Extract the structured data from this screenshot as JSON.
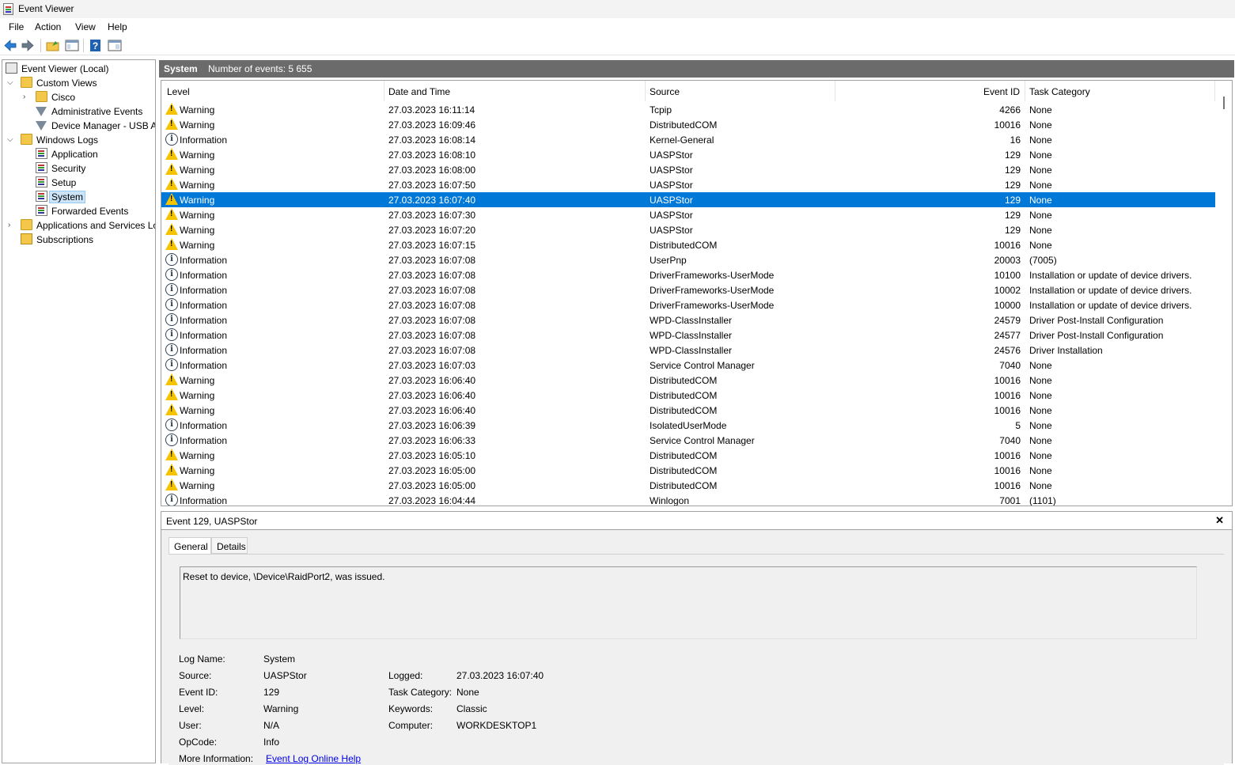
{
  "window": {
    "title": "Event Viewer"
  },
  "menu": [
    "File",
    "Action",
    "View",
    "Help"
  ],
  "tree": {
    "root": "Event Viewer (Local)",
    "custom_views": "Custom Views",
    "cisco": "Cisco",
    "admin_events": "Administrative Events",
    "device_manager": "Device Manager - USB At",
    "windows_logs": "Windows Logs",
    "application": "Application",
    "security": "Security",
    "setup": "Setup",
    "system": "System",
    "forwarded": "Forwarded Events",
    "apps_services": "Applications and Services Lo",
    "subscriptions": "Subscriptions"
  },
  "list": {
    "title": "System",
    "count": "Number of events: 5 655",
    "columns": [
      "Level",
      "Date and Time",
      "Source",
      "Event ID",
      "Task Category"
    ],
    "rows": [
      [
        "Warning",
        "27.03.2023 16:11:14",
        "Tcpip",
        "4266",
        "None"
      ],
      [
        "Warning",
        "27.03.2023 16:09:46",
        "DistributedCOM",
        "10016",
        "None"
      ],
      [
        "Information",
        "27.03.2023 16:08:14",
        "Kernel-General",
        "16",
        "None"
      ],
      [
        "Warning",
        "27.03.2023 16:08:10",
        "UASPStor",
        "129",
        "None"
      ],
      [
        "Warning",
        "27.03.2023 16:08:00",
        "UASPStor",
        "129",
        "None"
      ],
      [
        "Warning",
        "27.03.2023 16:07:50",
        "UASPStor",
        "129",
        "None"
      ],
      [
        "Warning",
        "27.03.2023 16:07:40",
        "UASPStor",
        "129",
        "None"
      ],
      [
        "Warning",
        "27.03.2023 16:07:30",
        "UASPStor",
        "129",
        "None"
      ],
      [
        "Warning",
        "27.03.2023 16:07:20",
        "UASPStor",
        "129",
        "None"
      ],
      [
        "Warning",
        "27.03.2023 16:07:15",
        "DistributedCOM",
        "10016",
        "None"
      ],
      [
        "Information",
        "27.03.2023 16:07:08",
        "UserPnp",
        "20003",
        "(7005)"
      ],
      [
        "Information",
        "27.03.2023 16:07:08",
        "DriverFrameworks-UserMode",
        "10100",
        "Installation or update of device drivers."
      ],
      [
        "Information",
        "27.03.2023 16:07:08",
        "DriverFrameworks-UserMode",
        "10002",
        "Installation or update of device drivers."
      ],
      [
        "Information",
        "27.03.2023 16:07:08",
        "DriverFrameworks-UserMode",
        "10000",
        "Installation or update of device drivers."
      ],
      [
        "Information",
        "27.03.2023 16:07:08",
        "WPD-ClassInstaller",
        "24579",
        "Driver Post-Install Configuration"
      ],
      [
        "Information",
        "27.03.2023 16:07:08",
        "WPD-ClassInstaller",
        "24577",
        "Driver Post-Install Configuration"
      ],
      [
        "Information",
        "27.03.2023 16:07:08",
        "WPD-ClassInstaller",
        "24576",
        "Driver Installation"
      ],
      [
        "Information",
        "27.03.2023 16:07:03",
        "Service Control Manager",
        "7040",
        "None"
      ],
      [
        "Warning",
        "27.03.2023 16:06:40",
        "DistributedCOM",
        "10016",
        "None"
      ],
      [
        "Warning",
        "27.03.2023 16:06:40",
        "DistributedCOM",
        "10016",
        "None"
      ],
      [
        "Warning",
        "27.03.2023 16:06:40",
        "DistributedCOM",
        "10016",
        "None"
      ],
      [
        "Information",
        "27.03.2023 16:06:39",
        "IsolatedUserMode",
        "5",
        "None"
      ],
      [
        "Information",
        "27.03.2023 16:06:33",
        "Service Control Manager",
        "7040",
        "None"
      ],
      [
        "Warning",
        "27.03.2023 16:05:10",
        "DistributedCOM",
        "10016",
        "None"
      ],
      [
        "Warning",
        "27.03.2023 16:05:00",
        "DistributedCOM",
        "10016",
        "None"
      ],
      [
        "Warning",
        "27.03.2023 16:05:00",
        "DistributedCOM",
        "10016",
        "None"
      ],
      [
        "Information",
        "27.03.2023 16:04:44",
        "Winlogon",
        "7001",
        "(1101)"
      ]
    ],
    "selected_index": 6
  },
  "detail": {
    "title": "Event 129, UASPStor",
    "close": "✕",
    "tabs": [
      "General",
      "Details"
    ],
    "message": "Reset to device, \\Device\\RaidPort2, was issued.",
    "labels": {
      "log_name": "Log Name:",
      "source": "Source:",
      "event_id": "Event ID:",
      "level": "Level:",
      "user": "User:",
      "opcode": "OpCode:",
      "more_info": "More Information:",
      "logged": "Logged:",
      "task_category": "Task Category:",
      "keywords": "Keywords:",
      "computer": "Computer:"
    },
    "values": {
      "log_name": "System",
      "source": "UASPStor",
      "event_id": "129",
      "level": "Warning",
      "user": "N/A",
      "opcode": "Info",
      "more_info": "Event Log Online Help",
      "logged": "27.03.2023 16:07:40",
      "task_category": "None",
      "keywords": "Classic",
      "computer": "WORKDESKTOP1"
    }
  }
}
